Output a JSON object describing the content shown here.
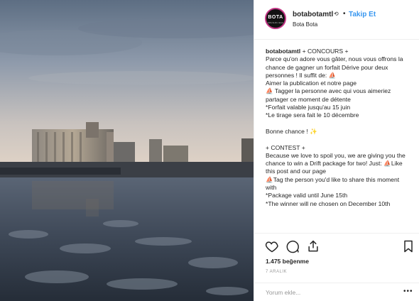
{
  "post": {
    "username": "botabotamtl",
    "verified_glyph": "⟲",
    "separator": "•",
    "follow_label": "Takip Et",
    "location": "Bota Bota",
    "avatar_text": "BOTA",
    "avatar_subtext": "SPA SUR L'EAU"
  },
  "caption": {
    "user": "botabotamtl",
    "lines": [
      "+ CONCOURS +",
      "Parce qu'on adore vous gâter, nous vous offrons la chance de gagner un forfait Dérive pour deux personnes ! Il suffit de: ⛵",
      "Aimer la publication et notre page",
      "⛵ Tagger la personne avec qui vous aimeriez partager ce moment de détente",
      "*Forfait valable jusqu'au 15 juin",
      "*Le tirage sera fait le 10 décembre",
      "",
      "Bonne chance ! ✨",
      "",
      "+ CONTEST +",
      "Because we love to spoil you, we are giving you the chance to win a Drift package for two! Just: ⛵Like this post and our page",
      "⛵Tag the person you'd like to share this moment with",
      "*Package valid until June 15th",
      "*The winner will ne chosen on December 10th"
    ]
  },
  "actions": {
    "icons": [
      "heart-icon",
      "comment-icon",
      "share-icon",
      "bookmark-icon"
    ]
  },
  "likes_text": "1.475 beğenme",
  "date_text": "7 ARALIK",
  "comment": {
    "placeholder": "Yorum ekle...",
    "more": "•••"
  },
  "colors": {
    "follow": "#3897f0",
    "text": "#262626",
    "muted": "#999999",
    "border": "#efefef"
  }
}
